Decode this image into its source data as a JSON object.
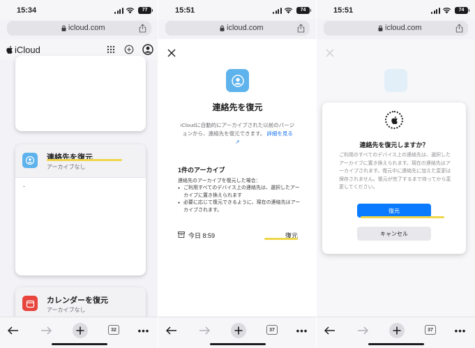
{
  "browser": {
    "url": "icloud.com"
  },
  "panels": [
    {
      "time": "15:34",
      "battery": "77",
      "tab_count": "32"
    },
    {
      "time": "15:51",
      "battery": "74",
      "tab_count": "37"
    },
    {
      "time": "15:51",
      "battery": "74",
      "tab_count": "37"
    }
  ],
  "panel1": {
    "brand": "iCloud",
    "contacts_card": {
      "title": "連絡先を復元",
      "subtitle": "アーカイブなし"
    },
    "calendar_card": {
      "title": "カレンダーを復元",
      "subtitle": "アーカイブなし"
    },
    "body_dash": "-"
  },
  "panel2": {
    "title": "連絡先を復元",
    "description": "iCloudに自動的にアーカイブされた以前のバージョンから、連絡先を復元できます。",
    "details_link": "詳細を見る ↗",
    "archive_heading": "1件のアーカイブ",
    "archive_intro": "連絡先のアーカイブを復元した場合：",
    "archive_notes": [
      "ご利用すべてのデバイス上の連絡先は、選択したアーカイブに置き換えられます",
      "必要に応じて復元できるように、現在の連絡先はアーカイブされます。"
    ],
    "archive_time": "今日 8:59",
    "restore_link": "復元"
  },
  "panel3": {
    "dialog_title": "連絡先を復元しますか？",
    "dialog_desc": "ご利用のすべてのデバイス上の連絡先は、選択したアーカイブに置き換えられます。現在の連絡先はアーカイブされます。復元中に連絡先に加えた変更は保存されません。復元が完了するまで待ってから変更してください。",
    "confirm_button": "復元",
    "cancel_button": "キャンセル"
  },
  "colors": {
    "accent": "#0a7aff",
    "highlight": "#f0d64a",
    "contacts_icon": "#5eb3ed",
    "calendar_icon": "#e8453c"
  },
  "icons": [
    "lock-icon",
    "share-icon",
    "apple-icon",
    "app-grid-icon",
    "add-circle-icon",
    "account-icon",
    "contacts-icon",
    "calendar-icon",
    "close-icon",
    "archive-box-icon",
    "back-icon",
    "forward-icon",
    "new-tab-icon",
    "tabs-icon",
    "more-icon"
  ]
}
